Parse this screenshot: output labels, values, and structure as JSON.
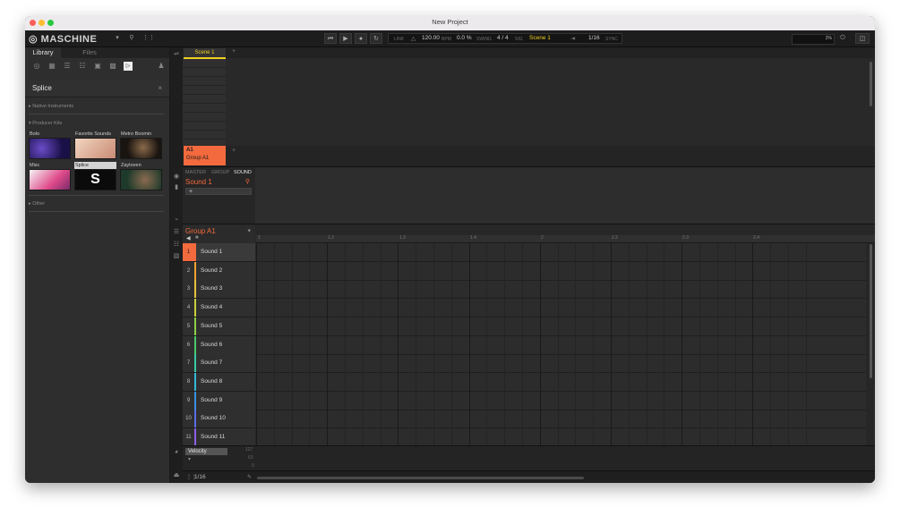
{
  "window": {
    "title": "New Project"
  },
  "header": {
    "logo": "MASCHINE",
    "link_label": "LINK",
    "tempo": "120.00",
    "tempo_unit": "BPM",
    "swing": "0.0 %",
    "swing_label": "SWING",
    "signature": "4 / 4",
    "signature_label": "SIG",
    "scene": "Scene 1",
    "quantize": "1/16",
    "sync_label": "SYNC",
    "cpu": "2%"
  },
  "library": {
    "tabs": [
      "Library",
      "Files"
    ],
    "active_tab": "Library",
    "product": "Splice",
    "sections": {
      "native": "Native Instruments",
      "producer": "Producer Kits",
      "other": "Other"
    },
    "kits": [
      {
        "label": "Bolo"
      },
      {
        "label": "Favorite Sounds"
      },
      {
        "label": "Metro Boomin"
      },
      {
        "label": "Misc"
      },
      {
        "label": "Splice",
        "selected": true
      },
      {
        "label": "Zaytoven"
      }
    ]
  },
  "arranger": {
    "scene_label": "Scene 1",
    "group_letter": "A1",
    "group_label": "Group A1"
  },
  "sound_panel": {
    "tabs": [
      "MASTER",
      "GROUP",
      "SOUND"
    ],
    "active_tab": "SOUND",
    "sound_name": "Sound 1",
    "plugin_add": "+"
  },
  "pattern": {
    "group_name": "Group A1",
    "ruler": [
      "1",
      "1.2",
      "1.3",
      "1.4",
      "2",
      "2.2",
      "2.3",
      "2.4"
    ],
    "pads": [
      {
        "num": "1",
        "name": "Sound 1",
        "color": "#f26a3d"
      },
      {
        "num": "2",
        "name": "Sound 2",
        "color": "#f0a030"
      },
      {
        "num": "3",
        "name": "Sound 3",
        "color": "#e8c23a"
      },
      {
        "num": "4",
        "name": "Sound 4",
        "color": "#c8d23c"
      },
      {
        "num": "5",
        "name": "Sound 5",
        "color": "#8fcf45"
      },
      {
        "num": "6",
        "name": "Sound 6",
        "color": "#4cc86a"
      },
      {
        "num": "7",
        "name": "Sound 7",
        "color": "#38c9a5"
      },
      {
        "num": "8",
        "name": "Sound 8",
        "color": "#35b8d8"
      },
      {
        "num": "9",
        "name": "Sound 9",
        "color": "#3a8fe0"
      },
      {
        "num": "10",
        "name": "Sound 10",
        "color": "#5a6ee8"
      },
      {
        "num": "11",
        "name": "Sound 11",
        "color": "#8a5ee6"
      }
    ],
    "velocity_label": "Velocity",
    "velocity_values": [
      "127",
      "63",
      "0"
    ],
    "step": "1/16"
  },
  "colors": {
    "accent": "#f26a3d",
    "scene": "#f0d020",
    "bg": "#262626"
  }
}
